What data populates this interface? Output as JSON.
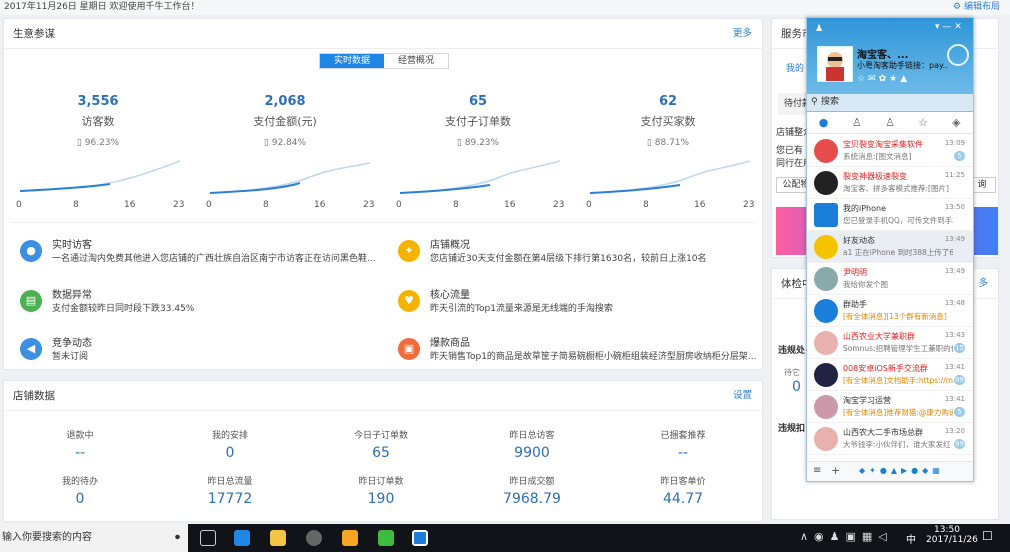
{
  "topbar": {
    "greeting": "2017年11月26日 星期日 欢迎使用千牛工作台！",
    "edit": "编辑布局"
  },
  "biz": {
    "title": "生意参谋",
    "more": "更多",
    "tabs": [
      "实时数据",
      "经营概况"
    ],
    "metrics": [
      {
        "value": "3,556",
        "label": "访客数",
        "pct": "96.23%"
      },
      {
        "value": "2,068",
        "label": "支付金额(元)",
        "pct": "92.84%"
      },
      {
        "value": "65",
        "label": "支付子订单数",
        "pct": "89.23%"
      },
      {
        "value": "62",
        "label": "支付买家数",
        "pct": "88.71%"
      }
    ],
    "ticks": [
      "0",
      "8",
      "16",
      "23"
    ]
  },
  "feeds": [
    {
      "title": "实时访客",
      "desc": "一名通过淘内免费其他进入您店铺的广西壮族自治区南宁市访客正在访问黑色鞋...",
      "color": "#3d8fe0",
      "icon": "mic-icon"
    },
    {
      "title": "店铺概况",
      "desc": "您店铺近30天支付金额在第4层级下排行第1630名，较前日上涨10名",
      "color": "#f5b300",
      "icon": "bulb-icon"
    },
    {
      "title": "数据异常",
      "desc": "支付金额较昨日同时段下跌33.45%",
      "color": "#4caf50",
      "icon": "chart-icon"
    },
    {
      "title": "核心流量",
      "desc": "昨天引流的Top1流量来源是无线端的手淘搜索",
      "color": "#f5b300",
      "icon": "heart-icon"
    },
    {
      "title": "竞争动态",
      "desc": "暂未订阅",
      "color": "#3d8fe0",
      "icon": "speaker-icon"
    },
    {
      "title": "爆款商品",
      "desc": "昨天销售Top1的商品是故草筐子简易碗橱柜小碗柜组装经济型厨房收纳柜分层架...",
      "color": "#f26b3a",
      "icon": "bag-icon"
    }
  ],
  "shop": {
    "title": "店铺数据",
    "settings": "设置",
    "row1": [
      {
        "label": "退款中",
        "value": "--"
      },
      {
        "label": "我的安排",
        "value": "0"
      },
      {
        "label": "今日子订单数",
        "value": "65"
      },
      {
        "label": "昨日总访客",
        "value": "9900"
      },
      {
        "label": "已捆套推荐",
        "value": "--"
      }
    ],
    "row2": [
      {
        "label": "我的待办",
        "value": "0"
      },
      {
        "label": "昨日总流量",
        "value": "17772"
      },
      {
        "label": "昨日订单数",
        "value": "190"
      },
      {
        "label": "昨日成交额",
        "value": "7968.79"
      },
      {
        "label": "昨日客单价",
        "value": "44.77"
      }
    ]
  },
  "right": {
    "service": "服务市",
    "my": "我的",
    "pending": "待付款",
    "shopcfg": "店铺整介",
    "desc1": "您已有",
    "desc2": "同行在用",
    "btn1": "公配物",
    "btn2": "询",
    "exp": "体检中",
    "more": "多",
    "check": "违规处",
    "wait": "待它",
    "zero": "0",
    "check2": "违规扣"
  },
  "qq": {
    "name": "淘宝客、...",
    "sig": "小粤淘客助手链接：pay...",
    "search": "搜索",
    "rows": [
      {
        "name": "宝贝裂变淘宝采集软件",
        "msg": "系统消息:[图文消息]",
        "time": "13:09",
        "badge": "5",
        "red": true,
        "color": "#e84d4d"
      },
      {
        "name": "裂变神器极速裂变",
        "msg": "淘宝客、拼多客模式推荐:[图片]",
        "time": "11:25",
        "badge": "",
        "red": true,
        "color": "#222"
      },
      {
        "name": "我的iPhone",
        "msg": "您已登录手机QQ，可传文件到手机",
        "time": "13:50",
        "badge": "",
        "red": false,
        "color": "#1a7fd8"
      },
      {
        "name": "好友动态",
        "msg": "a1 正在iPhone 到时388上传了6张照",
        "time": "13:49",
        "badge": "",
        "red": false,
        "color": "#f5c400"
      },
      {
        "name": "尹明明",
        "msg": "我给你发个图",
        "time": "13:49",
        "badge": "",
        "red": true,
        "color": "#8aa"
      },
      {
        "name": "群助手",
        "msg": "[有全体消息][13个群有新消息]",
        "time": "13:48",
        "badge": "",
        "red": false,
        "color": "#1a7fd8"
      },
      {
        "name": "山西农业大学兼职群",
        "msg": "Somnus:招聘管理学生工兼职的代",
        "time": "13:43",
        "badge": "15",
        "red": true,
        "color": "#e9b0b0"
      },
      {
        "name": "008安卓iOS新手交流群",
        "msg": "[有全体消息]文档助手:https://m.",
        "time": "13:41",
        "badge": "99",
        "red": true,
        "color": "#224"
      },
      {
        "name": "淘宝学习运营",
        "msg": "[有全体消息]推荐财猫:@康力购诵",
        "time": "13:41",
        "badge": "5",
        "red": false,
        "color": "#c9a"
      },
      {
        "name": "山西农大二手市场总群",
        "msg": "大爷钱李:小伙伴们，谁大家发红",
        "time": "13:20",
        "badge": "99",
        "red": false,
        "color": "#e9b0b0"
      }
    ]
  },
  "taskbar": {
    "search": "输入你要搜索的内容",
    "ime": "中",
    "time": "13:50",
    "date": "2017/11/26"
  }
}
